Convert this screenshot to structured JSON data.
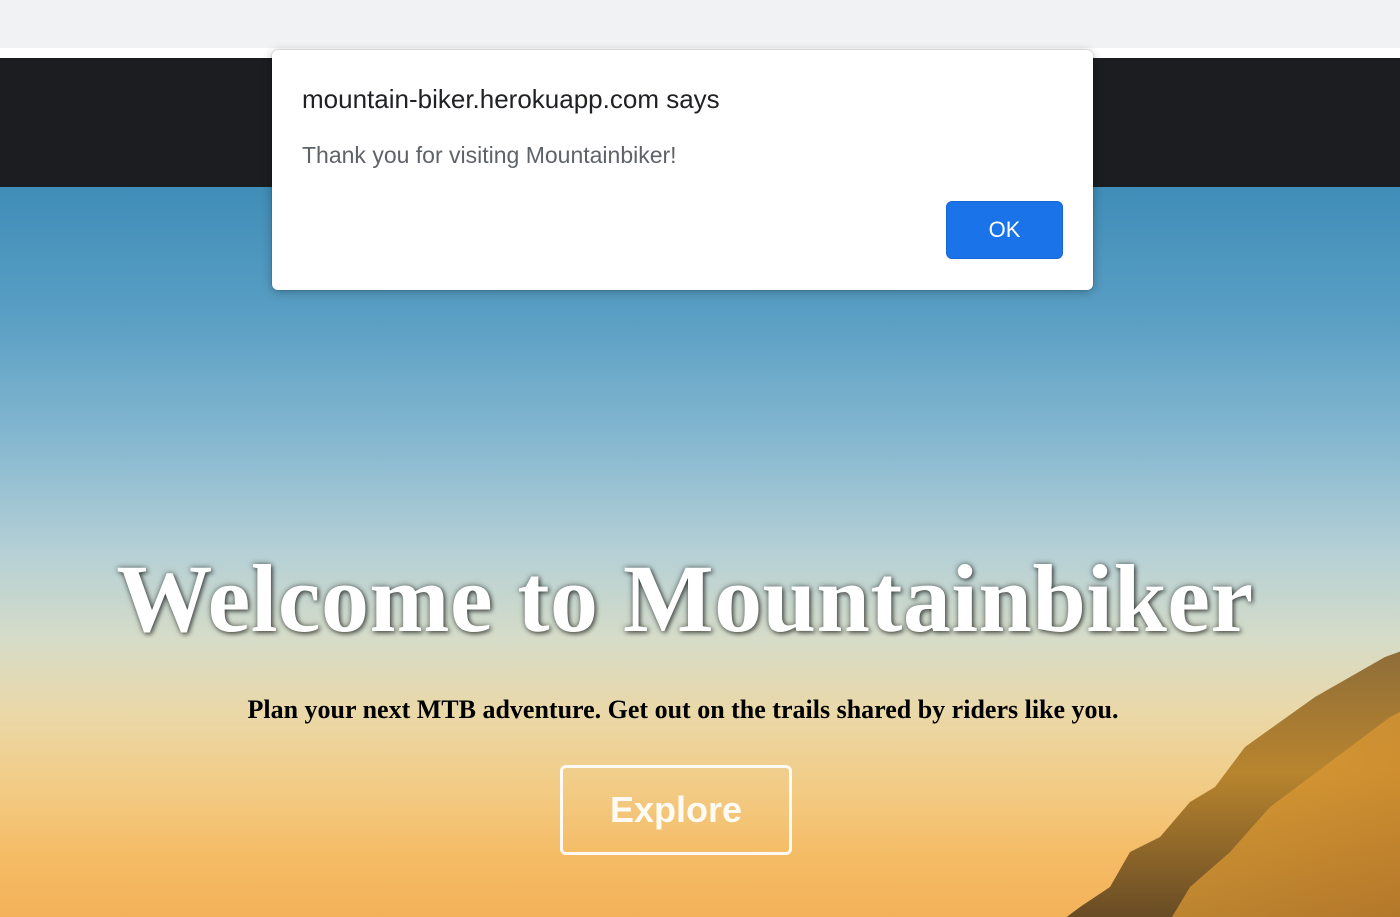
{
  "alert": {
    "origin": "mountain-biker.herokuapp.com says",
    "message": "Thank you for visiting Mountainbiker!",
    "ok_label": "OK"
  },
  "hero": {
    "title": "Welcome to Mountainbiker",
    "subtitle": "Plan your next MTB adventure. Get out on the trails shared by riders like you.",
    "explore_label": "Explore"
  },
  "colors": {
    "navbar": "#1c1d20",
    "ok_button": "#1a73e8",
    "sky_top": "#3f8db8",
    "sky_bottom": "#f3b25a"
  }
}
